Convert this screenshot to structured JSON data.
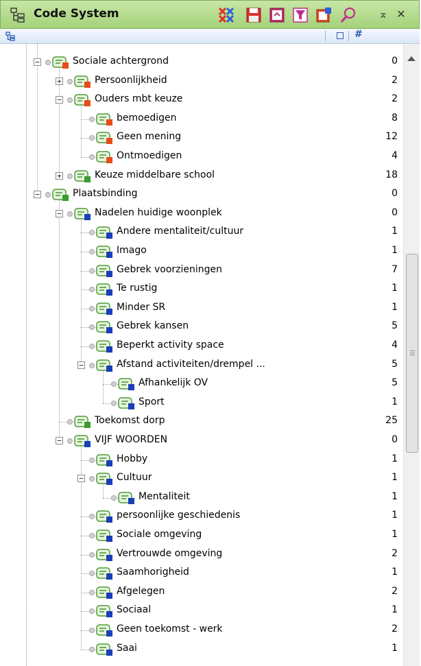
{
  "window": {
    "title": "Code System",
    "toolbar": [
      {
        "name": "activate-codes-icon"
      },
      {
        "name": "save-icon"
      },
      {
        "name": "export-icon"
      },
      {
        "name": "filter-icon"
      },
      {
        "name": "new-code-icon"
      },
      {
        "name": "search-icon"
      }
    ],
    "pin_glyph": "⌅",
    "close_glyph": "✕"
  },
  "header": {
    "count_column": "#"
  },
  "colors": {
    "red": "#e84b1c",
    "blue": "#1a3fb8",
    "green": "#3c9a30"
  },
  "tree": [
    {
      "label": "Sociale achtergrond",
      "count": "0",
      "depth": 1,
      "expander": "minus",
      "color": "red"
    },
    {
      "label": "Persoonlijkheid",
      "count": "2",
      "depth": 2,
      "expander": "plus",
      "color": "red"
    },
    {
      "label": "Ouders mbt keuze",
      "count": "2",
      "depth": 2,
      "expander": "minus",
      "color": "red"
    },
    {
      "label": "bemoedigen",
      "count": "8",
      "depth": 3,
      "expander": "none",
      "color": "red"
    },
    {
      "label": "Geen mening",
      "count": "12",
      "depth": 3,
      "expander": "none",
      "color": "red"
    },
    {
      "label": "Ontmoedigen",
      "count": "4",
      "depth": 3,
      "expander": "none",
      "color": "red"
    },
    {
      "label": "Keuze middelbare school",
      "count": "18",
      "depth": 2,
      "expander": "plus",
      "color": "green"
    },
    {
      "label": "Plaatsbinding",
      "count": "0",
      "depth": 1,
      "expander": "minus",
      "color": "green"
    },
    {
      "label": "Nadelen huidige woonplek",
      "count": "0",
      "depth": 2,
      "expander": "minus",
      "color": "blue"
    },
    {
      "label": "Andere mentaliteit/cultuur",
      "count": "1",
      "depth": 3,
      "expander": "none",
      "color": "blue"
    },
    {
      "label": "Imago",
      "count": "1",
      "depth": 3,
      "expander": "none",
      "color": "blue"
    },
    {
      "label": "Gebrek voorzieningen",
      "count": "7",
      "depth": 3,
      "expander": "none",
      "color": "blue"
    },
    {
      "label": "Te rustig",
      "count": "1",
      "depth": 3,
      "expander": "none",
      "color": "blue"
    },
    {
      "label": "Minder SR",
      "count": "1",
      "depth": 3,
      "expander": "none",
      "color": "blue"
    },
    {
      "label": "Gebrek kansen",
      "count": "5",
      "depth": 3,
      "expander": "none",
      "color": "blue"
    },
    {
      "label": "Beperkt activity space",
      "count": "4",
      "depth": 3,
      "expander": "none",
      "color": "blue"
    },
    {
      "label": "Afstand activiteiten/drempel ...",
      "count": "5",
      "depth": 3,
      "expander": "minus",
      "color": "blue"
    },
    {
      "label": "Afhankelijk OV",
      "count": "5",
      "depth": 4,
      "expander": "none",
      "color": "blue"
    },
    {
      "label": "Sport",
      "count": "1",
      "depth": 4,
      "expander": "none",
      "color": "blue"
    },
    {
      "label": "Toekomst dorp",
      "count": "25",
      "depth": 2,
      "expander": "none",
      "color": "green"
    },
    {
      "label": "VIJF WOORDEN",
      "count": "0",
      "depth": 2,
      "expander": "minus",
      "color": "blue"
    },
    {
      "label": "Hobby",
      "count": "1",
      "depth": 3,
      "expander": "none",
      "color": "blue"
    },
    {
      "label": "Cultuur",
      "count": "1",
      "depth": 3,
      "expander": "minus",
      "color": "blue"
    },
    {
      "label": "Mentaliteit",
      "count": "1",
      "depth": 4,
      "expander": "none",
      "color": "blue"
    },
    {
      "label": "persoonlijke geschiedenis",
      "count": "1",
      "depth": 3,
      "expander": "none",
      "color": "blue"
    },
    {
      "label": "Sociale omgeving",
      "count": "1",
      "depth": 3,
      "expander": "none",
      "color": "blue"
    },
    {
      "label": "Vertrouwde omgeving",
      "count": "2",
      "depth": 3,
      "expander": "none",
      "color": "blue"
    },
    {
      "label": "Saamhorigheid",
      "count": "1",
      "depth": 3,
      "expander": "none",
      "color": "blue"
    },
    {
      "label": "Afgelegen",
      "count": "2",
      "depth": 3,
      "expander": "none",
      "color": "blue"
    },
    {
      "label": "Sociaal",
      "count": "1",
      "depth": 3,
      "expander": "none",
      "color": "blue"
    },
    {
      "label": "Geen toekomst - werk",
      "count": "2",
      "depth": 3,
      "expander": "none",
      "color": "blue"
    },
    {
      "label": "Saai",
      "count": "1",
      "depth": 3,
      "expander": "none",
      "color": "blue"
    }
  ]
}
